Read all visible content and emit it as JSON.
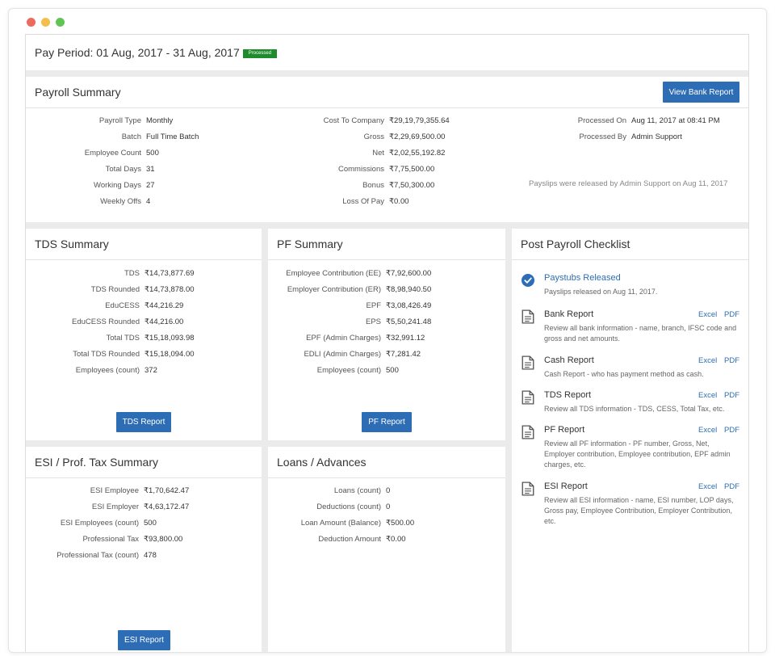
{
  "pay_period": {
    "label": "Pay Period: 01 Aug, 2017 - 31 Aug, 2017",
    "status_badge": "Processed"
  },
  "payroll_summary": {
    "title": "Payroll Summary",
    "view_bank_report_label": "View Bank Report",
    "col1": [
      {
        "label": "Payroll Type",
        "value": "Monthly"
      },
      {
        "label": "Batch",
        "value": "Full Time Batch"
      },
      {
        "label": "Employee Count",
        "value": "500"
      },
      {
        "label": "Total Days",
        "value": "31"
      },
      {
        "label": "Working Days",
        "value": "27"
      },
      {
        "label": "Weekly Offs",
        "value": "4"
      }
    ],
    "col2": [
      {
        "label": "Cost To Company",
        "value": "₹29,19,79,355.64"
      },
      {
        "label": "Gross",
        "value": "₹2,29,69,500.00"
      },
      {
        "label": "Net",
        "value": "₹2,02,55,192.82"
      },
      {
        "label": "Commissions",
        "value": "₹7,75,500.00"
      },
      {
        "label": "Bonus",
        "value": "₹7,50,300.00"
      },
      {
        "label": "Loss Of Pay",
        "value": "₹0.00"
      }
    ],
    "col3": [
      {
        "label": "Processed On",
        "value": "Aug 11, 2017 at 08:41 PM"
      },
      {
        "label": "Processed By",
        "value": "Admin Support"
      }
    ],
    "release_note": "Payslips were released by Admin Support on Aug 11, 2017"
  },
  "tds_summary": {
    "title": "TDS Summary",
    "button_label": "TDS Report",
    "rows": [
      {
        "label": "TDS",
        "value": "₹14,73,877.69"
      },
      {
        "label": "TDS Rounded",
        "value": "₹14,73,878.00"
      },
      {
        "label": "EduCESS",
        "value": "₹44,216.29"
      },
      {
        "label": "EduCESS Rounded",
        "value": "₹44,216.00"
      },
      {
        "label": "Total TDS",
        "value": "₹15,18,093.98"
      },
      {
        "label": "Total TDS Rounded",
        "value": "₹15,18,094.00"
      },
      {
        "label": "Employees (count)",
        "value": "372"
      }
    ]
  },
  "pf_summary": {
    "title": "PF Summary",
    "button_label": "PF Report",
    "rows": [
      {
        "label": "Employee Contribution (EE)",
        "value": "₹7,92,600.00"
      },
      {
        "label": "Employer Contribution (ER)",
        "value": "₹8,98,940.50"
      },
      {
        "label": "EPF",
        "value": "₹3,08,426.49"
      },
      {
        "label": "EPS",
        "value": "₹5,50,241.48"
      },
      {
        "label": "EPF (Admin Charges)",
        "value": "₹32,991.12"
      },
      {
        "label": "EDLI (Admin Charges)",
        "value": "₹7,281.42"
      },
      {
        "label": "Employees (count)",
        "value": "500"
      }
    ]
  },
  "esi_summary": {
    "title": "ESI / Prof. Tax Summary",
    "button_label": "ESI Report",
    "rows": [
      {
        "label": "ESI Employee",
        "value": "₹1,70,642.47"
      },
      {
        "label": "ESI Employer",
        "value": "₹4,63,172.47"
      },
      {
        "label": "ESI Employees (count)",
        "value": "500"
      },
      {
        "label": "Professional Tax",
        "value": "₹93,800.00"
      },
      {
        "label": "Professional Tax (count)",
        "value": "478"
      }
    ]
  },
  "loans": {
    "title": "Loans / Advances",
    "rows": [
      {
        "label": "Loans (count)",
        "value": "0"
      },
      {
        "label": "Deductions (count)",
        "value": "0"
      },
      {
        "label": "Loan Amount (Balance)",
        "value": "₹500.00"
      },
      {
        "label": "Deduction Amount",
        "value": "₹0.00"
      }
    ]
  },
  "checklist": {
    "title": "Post Payroll Checklist",
    "excel_label": "Excel",
    "pdf_label": "PDF",
    "items": [
      {
        "title": "Paystubs Released",
        "desc": "Payslips released on Aug 11, 2017.",
        "icon": "check-circle-icon"
      },
      {
        "title": "Bank Report",
        "desc": "Review all bank information - name, branch, IFSC code and gross and net amounts.",
        "icon": "document-icon"
      },
      {
        "title": "Cash Report",
        "desc": "Cash Report - who has payment method as cash.",
        "icon": "document-icon"
      },
      {
        "title": "TDS Report",
        "desc": "Review all TDS information - TDS, CESS, Total Tax, etc.",
        "icon": "document-icon"
      },
      {
        "title": "PF Report",
        "desc": "Review all PF information - PF number, Gross, Net, Employer contribution, Employee contribution, EPF admin charges, etc.",
        "icon": "document-icon"
      },
      {
        "title": "ESI Report",
        "desc": "Review all ESI information - name, ESI number, LOP days, Gross pay, Employee Contribution, Employer Contribution, etc.",
        "icon": "document-icon"
      }
    ]
  },
  "colors": {
    "accent": "#2d6db5",
    "processed_green": "#1e8c2d",
    "background": "#ebebeb"
  }
}
